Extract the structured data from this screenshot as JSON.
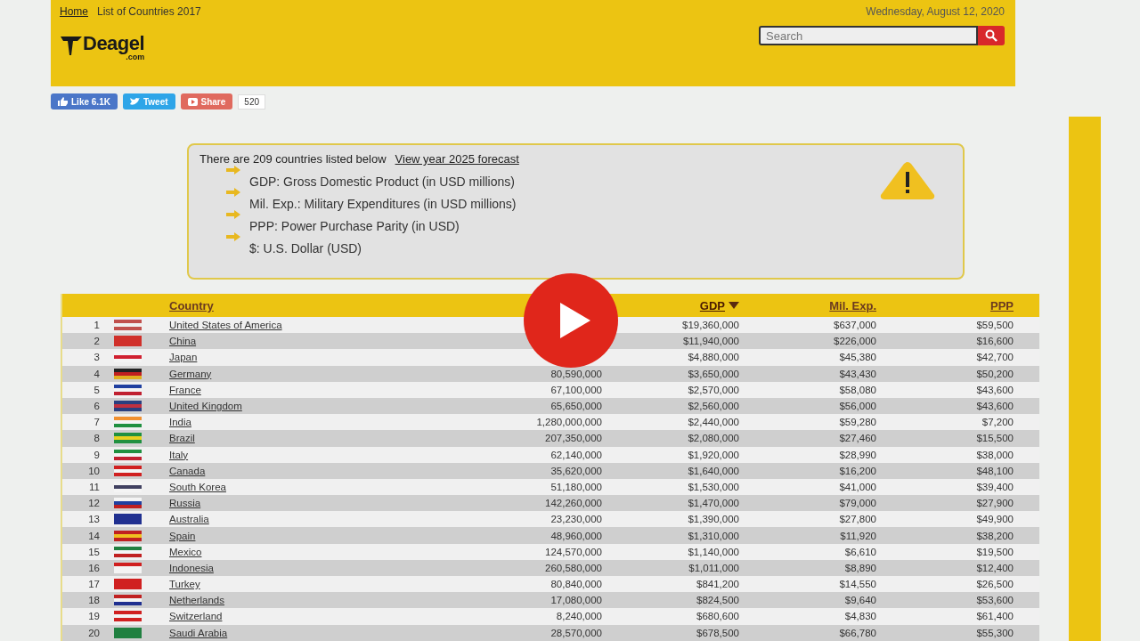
{
  "breadcrumb": {
    "home": "Home",
    "current": "List of Countries 2017"
  },
  "date": "Wednesday, August 12, 2020",
  "logo": {
    "name": "Deagel",
    "suffix": ".com"
  },
  "search": {
    "placeholder": "Search"
  },
  "social": {
    "like": "Like 6.1K",
    "tweet": "Tweet",
    "share": "Share",
    "count": "520"
  },
  "info": {
    "intro": "There are 209 countries listed below",
    "link": "View year 2025 forecast",
    "notes": [
      "GDP: Gross Domestic Product (in USD millions)",
      "Mil. Exp.: Military Expenditures (in USD millions)",
      "PPP: Power Purchase Parity (in USD)",
      "$: U.S. Dollar (USD)"
    ]
  },
  "table": {
    "columns": [
      {
        "label": "Country",
        "sorted": false
      },
      {
        "label": "GDP",
        "sorted": true
      },
      {
        "label": "Mil. Exp.",
        "sorted": false
      },
      {
        "label": "PPP",
        "sorted": false
      }
    ],
    "rows": [
      {
        "rank": "1",
        "country": "United States of America",
        "gdp": "$19,360,000",
        "mil": "$637,000",
        "ppp": "$59,500"
      },
      {
        "rank": "2",
        "country": "China",
        "gdp": "$11,940,000",
        "mil": "$226,000",
        "ppp": "$16,600"
      },
      {
        "rank": "3",
        "country": "Japan",
        "gdp": "$4,880,000",
        "mil": "$45,380",
        "ppp": "$42,700"
      },
      {
        "rank": "4",
        "country": "Germany",
        "population": "80,590,000",
        "gdp": "$3,650,000",
        "mil": "$43,430",
        "ppp": "$50,200"
      },
      {
        "rank": "5",
        "country": "France",
        "population": "67,100,000",
        "gdp": "$2,570,000",
        "mil": "$58,080",
        "ppp": "$43,600"
      },
      {
        "rank": "6",
        "country": "United Kingdom",
        "population": "65,650,000",
        "gdp": "$2,560,000",
        "mil": "$56,000",
        "ppp": "$43,600"
      },
      {
        "rank": "7",
        "country": "India",
        "population": "1,280,000,000",
        "gdp": "$2,440,000",
        "mil": "$59,280",
        "ppp": "$7,200"
      },
      {
        "rank": "8",
        "country": "Brazil",
        "population": "207,350,000",
        "gdp": "$2,080,000",
        "mil": "$27,460",
        "ppp": "$15,500"
      },
      {
        "rank": "9",
        "country": "Italy",
        "population": "62,140,000",
        "gdp": "$1,920,000",
        "mil": "$28,990",
        "ppp": "$38,000"
      },
      {
        "rank": "10",
        "country": "Canada",
        "population": "35,620,000",
        "gdp": "$1,640,000",
        "mil": "$16,200",
        "ppp": "$48,100"
      },
      {
        "rank": "11",
        "country": "South Korea",
        "population": "51,180,000",
        "gdp": "$1,530,000",
        "mil": "$41,000",
        "ppp": "$39,400"
      },
      {
        "rank": "12",
        "country": "Russia",
        "population": "142,260,000",
        "gdp": "$1,470,000",
        "mil": "$79,000",
        "ppp": "$27,900"
      },
      {
        "rank": "13",
        "country": "Australia",
        "population": "23,230,000",
        "gdp": "$1,390,000",
        "mil": "$27,800",
        "ppp": "$49,900"
      },
      {
        "rank": "14",
        "country": "Spain",
        "population": "48,960,000",
        "gdp": "$1,310,000",
        "mil": "$11,920",
        "ppp": "$38,200"
      },
      {
        "rank": "15",
        "country": "Mexico",
        "population": "124,570,000",
        "gdp": "$1,140,000",
        "mil": "$6,610",
        "ppp": "$19,500"
      },
      {
        "rank": "16",
        "country": "Indonesia",
        "population": "260,580,000",
        "gdp": "$1,011,000",
        "mil": "$8,890",
        "ppp": "$12,400"
      },
      {
        "rank": "17",
        "country": "Turkey",
        "population": "80,840,000",
        "gdp": "$841,200",
        "mil": "$14,550",
        "ppp": "$26,500"
      },
      {
        "rank": "18",
        "country": "Netherlands",
        "population": "17,080,000",
        "gdp": "$824,500",
        "mil": "$9,640",
        "ppp": "$53,600"
      },
      {
        "rank": "19",
        "country": "Switzerland",
        "population": "8,240,000",
        "gdp": "$680,600",
        "mil": "$4,830",
        "ppp": "$61,400"
      },
      {
        "rank": "20",
        "country": "Saudi Arabia",
        "population": "28,570,000",
        "gdp": "$678,500",
        "mil": "$66,780",
        "ppp": "$55,300"
      }
    ]
  }
}
